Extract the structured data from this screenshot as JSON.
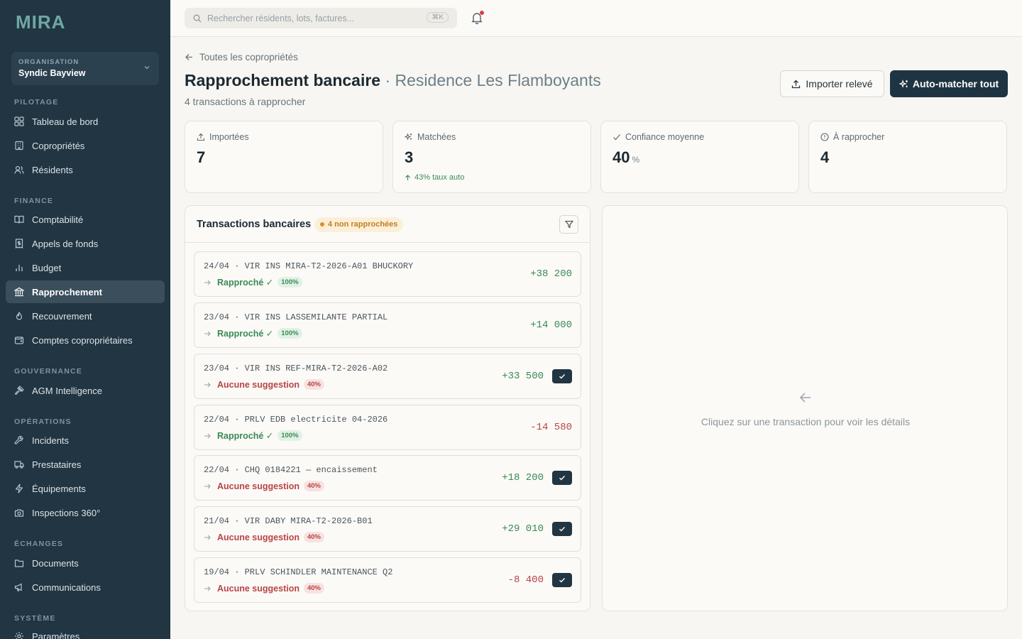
{
  "app": {
    "logo": "MIRA"
  },
  "sidebar": {
    "org_label": "ORGANISATION",
    "org_name": "Syndic Bayview",
    "sections": {
      "pilotage": "PILOTAGE",
      "finance": "FINANCE",
      "gouvernance": "GOUVERNANCE",
      "operations": "OPÉRATIONS",
      "echanges": "ÉCHANGES",
      "systeme": "SYSTÈME"
    },
    "items": {
      "dashboard": "Tableau de bord",
      "coproprietes": "Copropriétés",
      "residents": "Résidents",
      "comptabilite": "Comptabilité",
      "appels": "Appels de fonds",
      "budget": "Budget",
      "rapprochement": "Rapprochement",
      "recouvrement": "Recouvrement",
      "comptes": "Comptes copropriétaires",
      "agm": "AGM Intelligence",
      "incidents": "Incidents",
      "prestataires": "Prestataires",
      "equipements": "Équipements",
      "inspections": "Inspections 360°",
      "documents": "Documents",
      "communications": "Communications",
      "parametres": "Paramètres"
    }
  },
  "topbar": {
    "search_placeholder": "Rechercher résidents, lots, factures...",
    "shortcut": "⌘K"
  },
  "header": {
    "back": "Toutes les copropriétés",
    "title": "Rapprochement bancaire",
    "title_sub": " · Residence Les Flamboyants",
    "subtitle": "4 transactions à rapprocher",
    "import_btn": "Importer relevé",
    "auto_btn": "Auto-matcher tout"
  },
  "stats": {
    "imported_label": "Importées",
    "imported_value": "7",
    "matched_label": "Matchées",
    "matched_value": "3",
    "matched_note": "43% taux auto",
    "confidence_label": "Confiance moyenne",
    "confidence_value": "40",
    "confidence_unit": "%",
    "pending_label": "À rapprocher",
    "pending_value": "4"
  },
  "transactions": {
    "title": "Transactions bancaires",
    "badge": "4 non rapprochées",
    "rows": [
      {
        "desc": "24/04 · VIR INS MIRA-T2-2026-A01 BHUCKORY",
        "status": "Rapproché ✓",
        "pct": "100%",
        "amount": "+38 200"
      },
      {
        "desc": "23/04 · VIR INS LASSEMILANTE PARTIAL",
        "status": "Rapproché ✓",
        "pct": "100%",
        "amount": "+14 000"
      },
      {
        "desc": "23/04 · VIR INS REF-MIRA-T2-2026-A02",
        "status": "Aucune suggestion",
        "pct": "40%",
        "amount": "+33 500"
      },
      {
        "desc": "22/04 · PRLV EDB electricite 04-2026",
        "status": "Rapproché ✓",
        "pct": "100%",
        "amount": "-14 580"
      },
      {
        "desc": "22/04 · CHQ 0184221 — encaissement",
        "status": "Aucune suggestion",
        "pct": "40%",
        "amount": "+18 200"
      },
      {
        "desc": "21/04 · VIR DABY MIRA-T2-2026-B01",
        "status": "Aucune suggestion",
        "pct": "40%",
        "amount": "+29 010"
      },
      {
        "desc": "19/04 · PRLV SCHINDLER MAINTENANCE Q2",
        "status": "Aucune suggestion",
        "pct": "40%",
        "amount": "-8 400"
      }
    ]
  },
  "detail": {
    "empty_text": "Cliquez sur une transaction pour voir les détails"
  }
}
